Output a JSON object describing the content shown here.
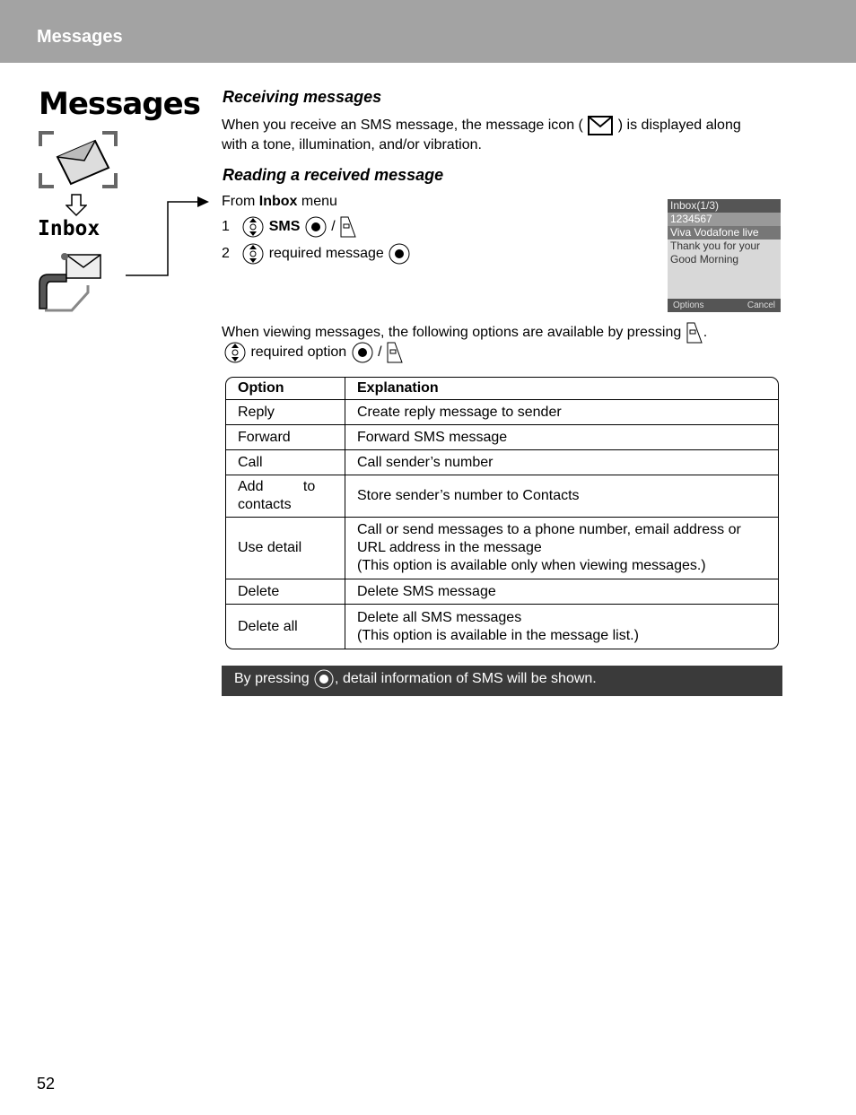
{
  "header": {
    "title": "Messages"
  },
  "side": {
    "title": "Messages",
    "inbox": "Inbox"
  },
  "receiving": {
    "heading": "Receiving messages",
    "text_before": "When you receive an SMS message, the message icon (",
    "text_after": ") is displayed along",
    "text_line2": "with a tone, illumination, and/or vibration."
  },
  "reading": {
    "heading": "Reading a received message",
    "from": "From ",
    "from_bold": "Inbox",
    "from_after": " menu",
    "step1_num": "1",
    "step1_label": "SMS",
    "slash": "/",
    "step2_num": "2",
    "step2_label": "required message"
  },
  "screen": {
    "title": "Inbox(1/3)",
    "number": "1234567",
    "items": [
      "Viva Vodafone live",
      "Thank you for your",
      "Good Morning"
    ],
    "left_soft": "Options",
    "right_soft": "Cancel"
  },
  "options": {
    "intro": "When viewing messages, the following options are available by pressing",
    "period": ".",
    "line2": "required option",
    "slash": "/"
  },
  "table": {
    "headers": [
      "Option",
      "Explanation"
    ],
    "rows": [
      [
        "Reply",
        "Create reply message to sender"
      ],
      [
        "Forward",
        "Forward SMS message"
      ],
      [
        "Call",
        "Call sender’s number"
      ],
      [
        "Add to contacts",
        "Store sender’s number to Contacts"
      ],
      [
        "Use detail",
        "Call or send messages to a phone number, email address or URL address in the message\n(This option is available only when viewing messages.)"
      ],
      [
        "Delete",
        "Delete SMS message"
      ],
      [
        "Delete all",
        "Delete all SMS messages\n(This option is available in the message list.)"
      ]
    ]
  },
  "note": {
    "before": "By pressing ",
    "after": ", detail information of SMS will be shown."
  },
  "page_number": "52"
}
